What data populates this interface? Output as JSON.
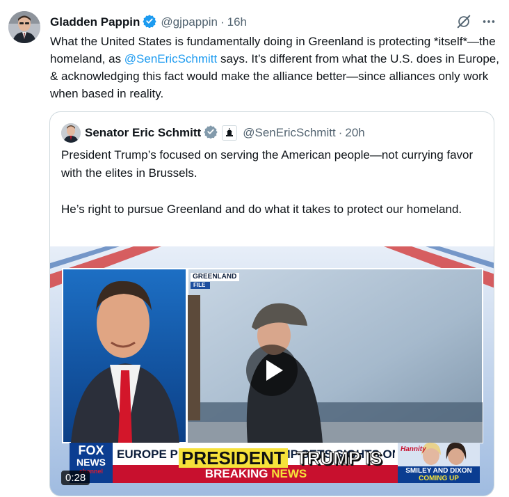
{
  "tweet": {
    "author_name": "Gladden Pappin",
    "handle": "@gjpappin",
    "separator": "·",
    "time": "16h",
    "text_part1": "What the United States is fundamentally doing in Greenland is protecting *itself*—the homeland, as ",
    "mention": "@SenEricSchmitt",
    "text_part2": " says. It’s different from what the U.S. does in Europe, & acknowledging this fact would make the alliance better—since alliances only work when based in reality."
  },
  "quoted_tweet": {
    "author_name": "Senator Eric Schmitt",
    "handle": "@SenEricSchmitt",
    "separator": "·",
    "time": "20h",
    "paragraph1": "President Trump’s focused on serving the American people—not currying favor with the elites in Brussels.",
    "paragraph2": "He’s right to pursue Greenland and do what it takes to protect our homeland."
  },
  "video": {
    "location_tag": "GREENLAND",
    "file_tag": "FILE",
    "ticker_headline": "EUROPE PROTESTS AS TRUMP SETS SIGHTS ON GREENLAND",
    "caption_word1": "PRESIDENT",
    "caption_word2": "TRUMP IS",
    "breaking_label": "BREAKING",
    "news_label": "NEWS",
    "network_logo_line1": "FOX",
    "network_logo_line2": "NEWS",
    "network_logo_line3": "channel",
    "promo_show": "Hannity",
    "promo_line1": "SMILEY AND DIXON",
    "promo_line2": "COMING UP",
    "duration": "0:28"
  },
  "icons": {
    "verified": "verified-badge-icon",
    "grok": "grok-icon",
    "more": "more-icon",
    "play": "play-icon",
    "affiliation": "senate-affiliation-icon"
  },
  "colors": {
    "link": "#1d9bf0",
    "verified": "#1d9bf0",
    "muted": "#536471"
  }
}
